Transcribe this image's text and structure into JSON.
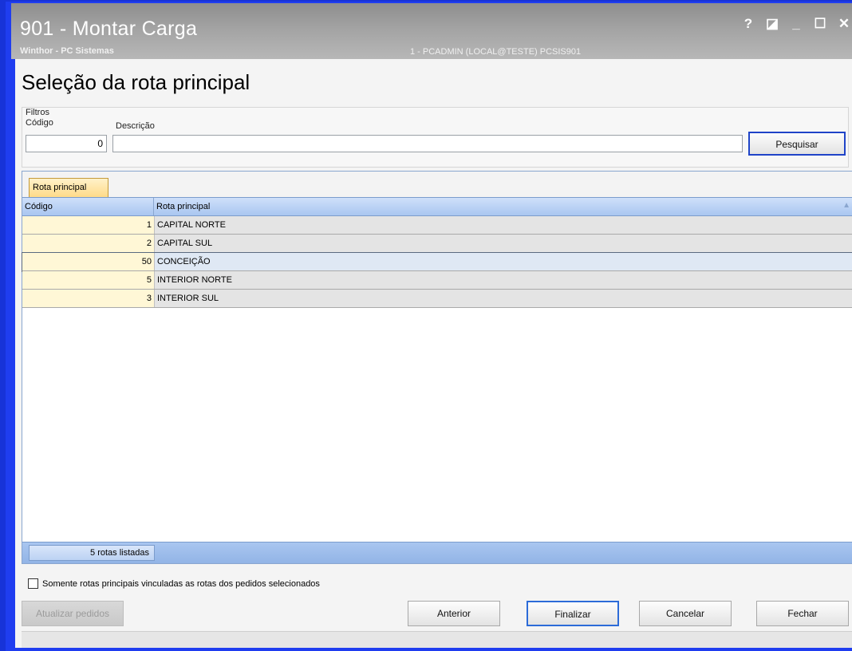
{
  "window": {
    "title": "901 - Montar Carga",
    "app_name": "Winthor - PC Sistemas",
    "user_info": "1 - PCADMIN (LOCAL@TESTE)  PCSIS901",
    "controls": {
      "help": "?",
      "edit": "◪",
      "minimize": "_",
      "maximize": "☐",
      "close": "✕"
    }
  },
  "page": {
    "title": "Seleção da rota principal"
  },
  "filters": {
    "group_label": "Filtros",
    "codigo_label": "Código",
    "codigo_value": "0",
    "descricao_label": "Descrição",
    "descricao_value": "",
    "search_button": "Pesquisar"
  },
  "grid": {
    "tab_label": "Rota principal",
    "columns": [
      "Código",
      "Rota principal"
    ],
    "rows": [
      {
        "code": "1",
        "name": "CAPITAL NORTE"
      },
      {
        "code": "2",
        "name": "CAPITAL SUL"
      },
      {
        "code": "50",
        "name": "CONCEIÇÃO"
      },
      {
        "code": "5",
        "name": "INTERIOR NORTE"
      },
      {
        "code": "3",
        "name": "INTERIOR SUL"
      }
    ],
    "count_text": "5 rotas listadas"
  },
  "checkbox": {
    "label": "Somente rotas principais vinculadas as rotas dos pedidos selecionados",
    "checked": false
  },
  "buttons": {
    "update_orders": "Atualizar pedidos",
    "previous": "Anterior",
    "finish": "Finalizar",
    "cancel": "Cancelar",
    "close": "Fechar"
  }
}
